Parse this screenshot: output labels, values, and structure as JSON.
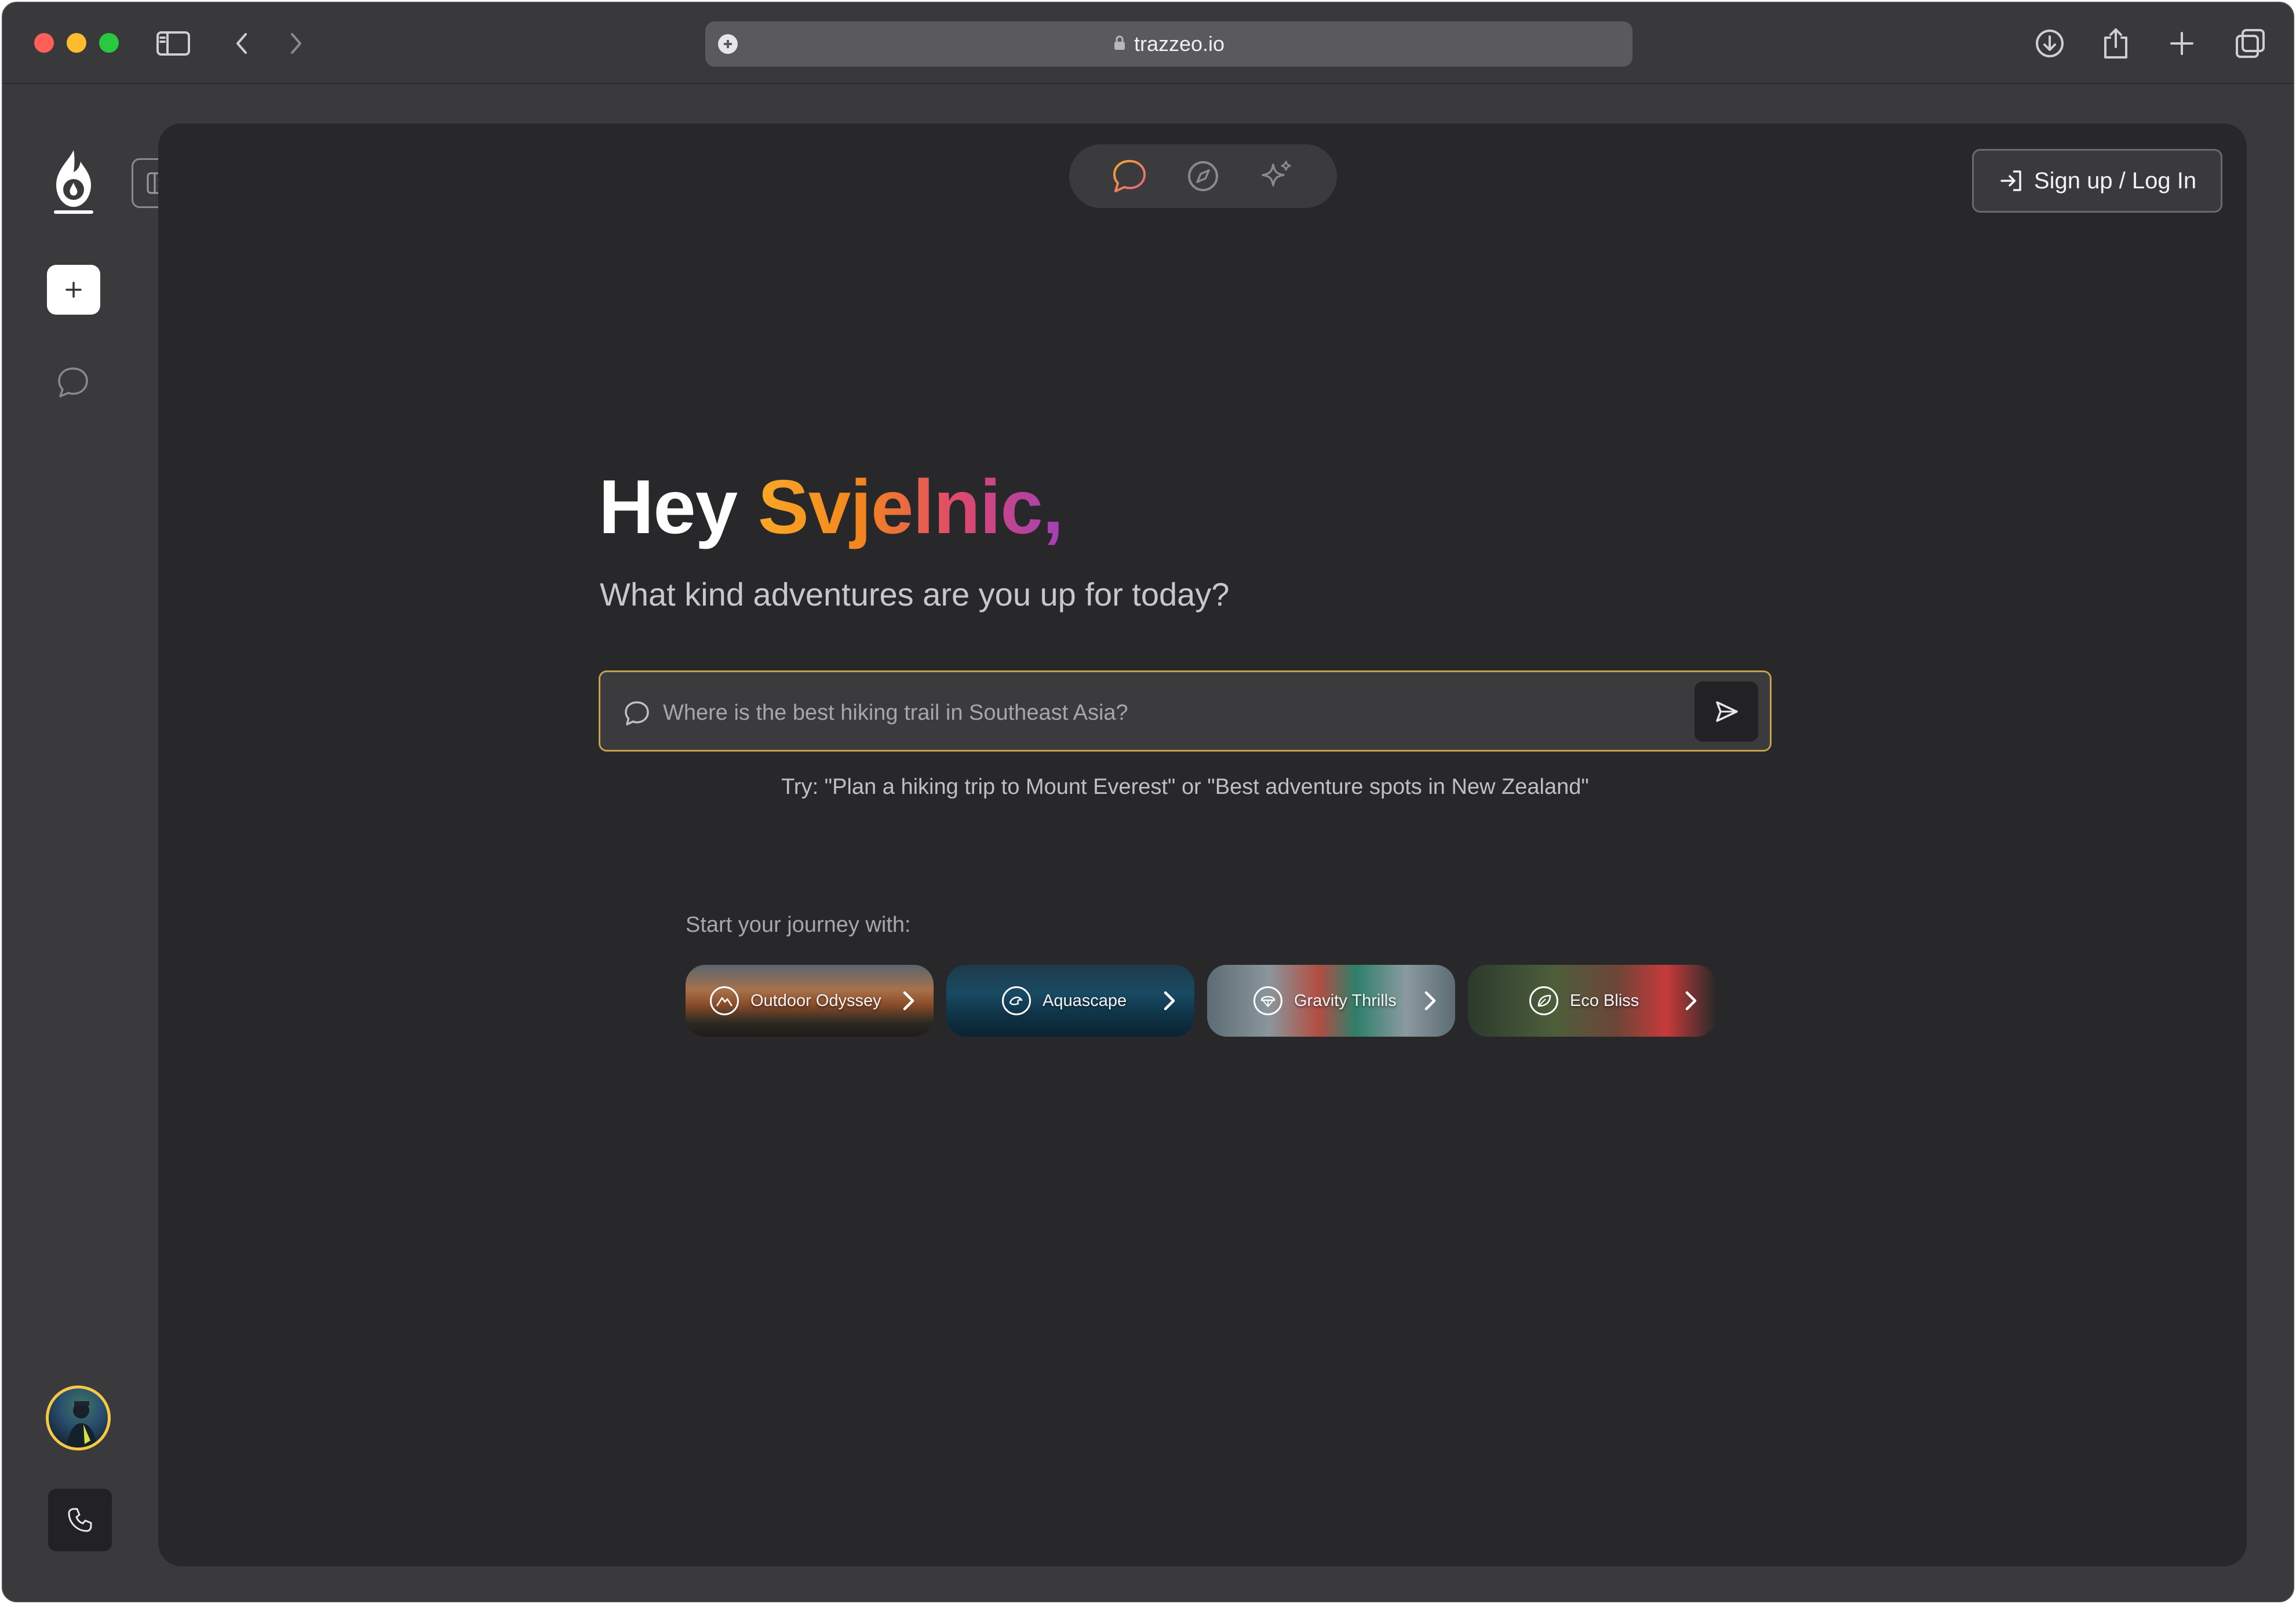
{
  "browser": {
    "url": "trazzeo.io"
  },
  "header": {
    "signup_label": "Sign up / Log In",
    "modes": [
      "chat-icon",
      "compass-icon",
      "sparkles-icon"
    ]
  },
  "main": {
    "greeting_prefix": "Hey ",
    "greeting_name": "Svjelnic,",
    "subtitle": "What kind adventures are you up for today?",
    "search_placeholder": "Where is the best hiking trail in Southeast Asia?",
    "hint": "Try: \"Plan a hiking trip to Mount Everest\" or \"Best adventure spots in New Zealand\"",
    "journey_label": "Start your journey with:",
    "journeys": [
      {
        "label": "Outdoor Odyssey",
        "icon": "mountain-icon"
      },
      {
        "label": "Aquascape",
        "icon": "wave-icon"
      },
      {
        "label": "Gravity Thrills",
        "icon": "parachute-icon"
      },
      {
        "label": "Eco Bliss",
        "icon": "leaf-icon"
      }
    ]
  },
  "colors": {
    "accent_gold": "#c2a24a",
    "gradient": [
      "#f9a825",
      "#f2841f",
      "#e04a6b",
      "#a23fb8"
    ],
    "panel": "#28282a"
  }
}
